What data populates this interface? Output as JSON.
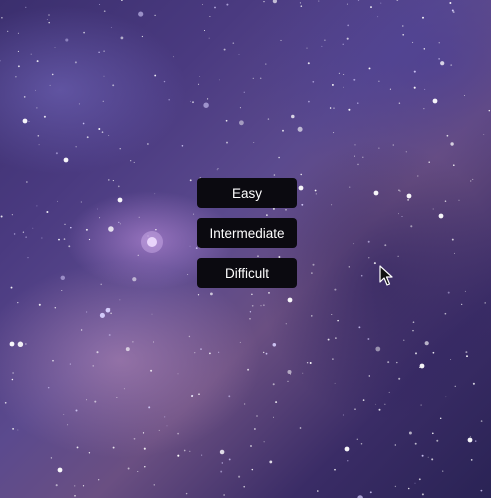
{
  "menu": {
    "buttons": [
      {
        "label": "Easy"
      },
      {
        "label": "Intermediate"
      },
      {
        "label": "Difficult"
      }
    ]
  },
  "icons": {
    "cursor": "mouse-pointer-icon"
  },
  "colors": {
    "button_bg": "#0b0a10",
    "button_text": "#ffffff"
  }
}
